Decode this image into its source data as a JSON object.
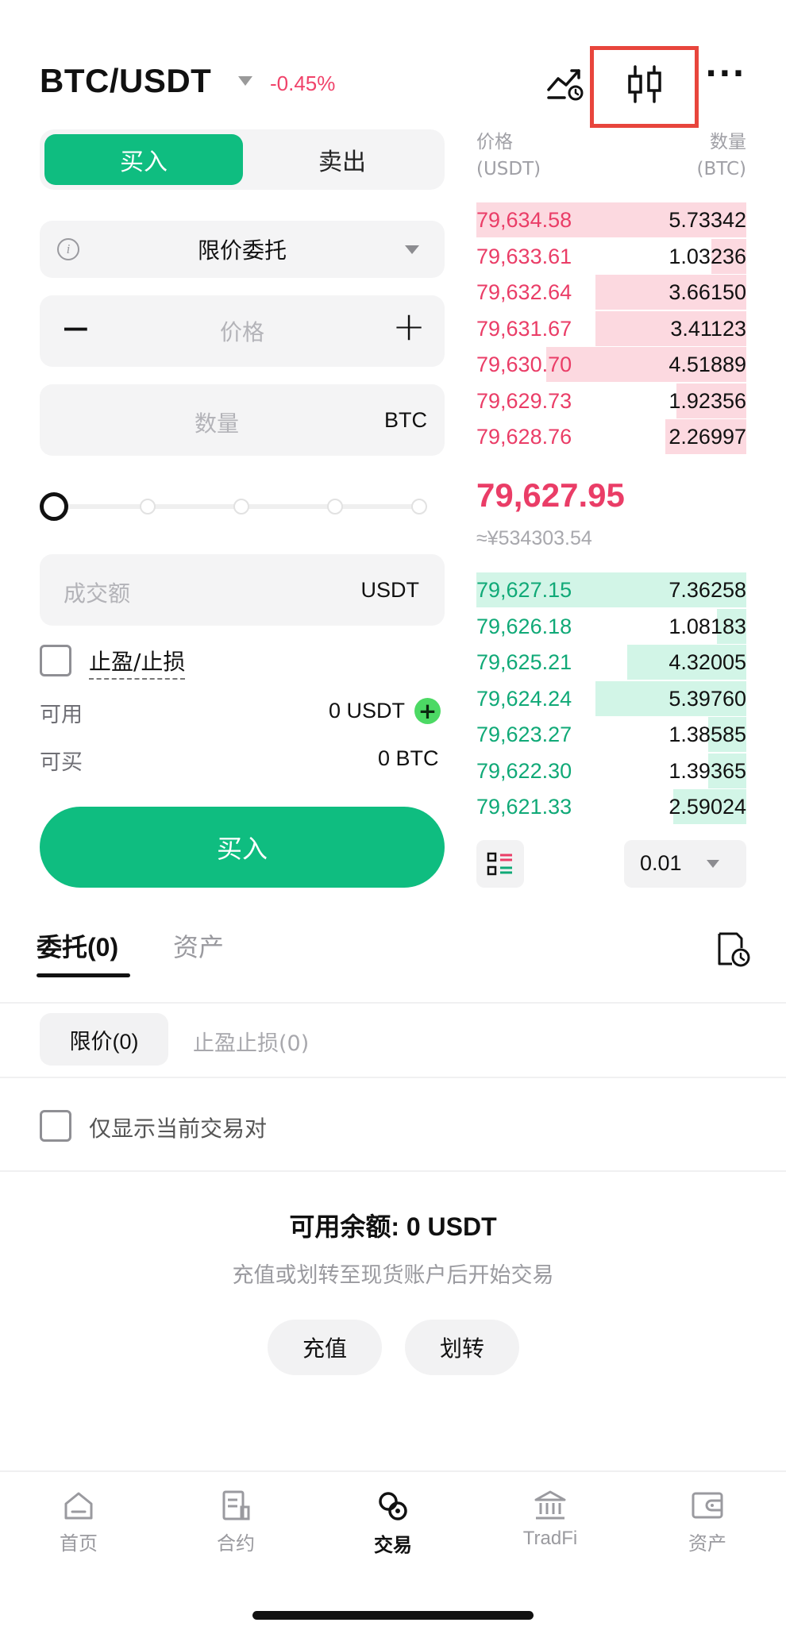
{
  "header": {
    "pair": "BTC/USDT",
    "change_pct": "-0.45%",
    "more": "···"
  },
  "trade": {
    "buy_tab": "买入",
    "sell_tab": "卖出",
    "order_type": "限价委托",
    "price_placeholder": "价格",
    "minus": "−",
    "plus": "+",
    "amount_placeholder": "数量",
    "amount_unit": "BTC",
    "total_placeholder": "成交额",
    "total_unit": "USDT",
    "tpsl_label": "止盈/止损",
    "available_label": "可用",
    "available_value": "0 USDT",
    "can_buy_label": "可买",
    "can_buy_value": "0 BTC",
    "submit_label": "买入",
    "slider_value": 0
  },
  "orderbook": {
    "price_header": "价格",
    "price_unit": "(USDT)",
    "qty_header": "数量",
    "qty_unit": "(BTC)",
    "asks": [
      {
        "price": "79,634.58",
        "qty": "5.73342",
        "depth": 1.0
      },
      {
        "price": "79,633.61",
        "qty": "1.03236",
        "depth": 0.13
      },
      {
        "price": "79,632.64",
        "qty": "3.66150",
        "depth": 0.56
      },
      {
        "price": "79,631.67",
        "qty": "3.41123",
        "depth": 0.56
      },
      {
        "price": "79,630.70",
        "qty": "4.51889",
        "depth": 0.74
      },
      {
        "price": "79,629.73",
        "qty": "1.92356",
        "depth": 0.26
      },
      {
        "price": "79,628.76",
        "qty": "2.26997",
        "depth": 0.3
      }
    ],
    "last_price": "79,627.95",
    "last_price_cny": "≈¥534303.54",
    "bids": [
      {
        "price": "79,627.15",
        "qty": "7.36258",
        "depth": 1.0
      },
      {
        "price": "79,626.18",
        "qty": "1.08183",
        "depth": 0.11
      },
      {
        "price": "79,625.21",
        "qty": "4.32005",
        "depth": 0.44
      },
      {
        "price": "79,624.24",
        "qty": "5.39760",
        "depth": 0.56
      },
      {
        "price": "79,623.27",
        "qty": "1.38585",
        "depth": 0.14
      },
      {
        "price": "79,622.30",
        "qty": "1.39365",
        "depth": 0.14
      },
      {
        "price": "79,621.33",
        "qty": "2.59024",
        "depth": 0.27
      }
    ],
    "precision": "0.01"
  },
  "orders": {
    "tab_orders": "委托(0)",
    "tab_assets": "资产",
    "sub_limit": "限价(0)",
    "sub_tpsl": "止盈止损(0)",
    "only_current": "仅显示当前交易对",
    "balance_title": "可用余额: 0 USDT",
    "balance_hint": "充值或划转至现货账户后开始交易",
    "deposit": "充值",
    "transfer": "划转"
  },
  "nav": {
    "home": "首页",
    "futures": "合约",
    "trade": "交易",
    "tradfi": "TradFi",
    "assets": "资产"
  },
  "colors": {
    "green": "#0fbd80",
    "red": "#ea3d67",
    "highlight": "#e8453c"
  }
}
